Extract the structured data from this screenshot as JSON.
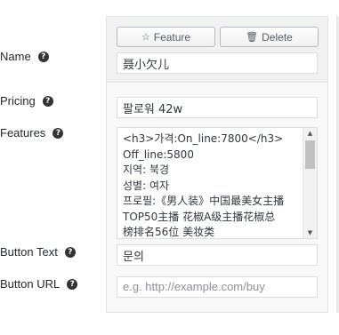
{
  "labels": {
    "name": "Name",
    "pricing": "Pricing",
    "features": "Features",
    "button_text": "Button Text",
    "button_url": "Button URL"
  },
  "help_glyph": "?",
  "toolbar": {
    "feature_label": "Feature",
    "feature_icon": "☆",
    "delete_label": "Delete",
    "delete_icon": "🗑"
  },
  "fields": {
    "name_value": "聂小欠儿",
    "pricing_value": "팔로워 42w",
    "features_value": "<h3>가격:On_line:7800</h3>\nOff_line:5800\n지역: 북경\n성별: 여자\n프로필:《男人装》中国最美女主播\nTOP50主播 花椒A级主播花椒总\n榜排名56位 美妆类",
    "button_text_value": "문의",
    "button_url_placeholder": "e.g. http://example.com/buy"
  },
  "colors": {
    "panel_bg": "#f8f8f8",
    "border": "#dddddd",
    "text": "#23282d"
  },
  "icons": {
    "help": "question-circle-icon",
    "feature": "star-outline-icon",
    "delete": "trash-icon",
    "scroll_up": "triangle-up-icon",
    "scroll_down": "triangle-down-icon"
  }
}
